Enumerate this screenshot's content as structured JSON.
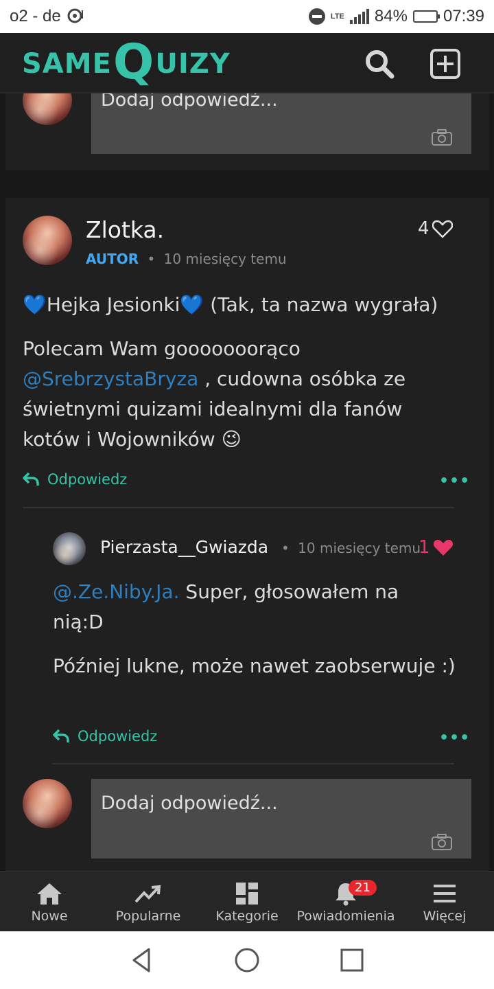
{
  "status_bar": {
    "carrier": "o2 - de",
    "network": "LTE",
    "battery_percent": "84%",
    "battery_level": 0.84,
    "time": "07:39"
  },
  "header": {
    "logo_same": "SAME",
    "logo_q": "Q",
    "logo_uizy": "UIZY",
    "brand_color": "#36c3a9",
    "search_icon": "search-icon",
    "add_icon": "plus-square-icon"
  },
  "top_reply": {
    "placeholder": "Dodaj odpowiedź..."
  },
  "comment": {
    "author": "Zlotka.",
    "badge": "AUTOR",
    "separator": "•",
    "time": "10 miesięcy temu",
    "likes": "4",
    "paragraph1": "💙Hejka Jesionki💙 (Tak, ta nazwa wygrała)",
    "p2_part1": "Polecam Wam gooooooorąco",
    "p2_mention": "@SrebrzystaBryza",
    "p2_part2": " , cudowna osóbka ze świetnymi quizami idealnymi dla fanów kotów i Wojowników 😉",
    "reply_label": "Odpowiedz",
    "more": "•••"
  },
  "nested_reply": {
    "author": "Pierzasta__Gwiazda",
    "separator": "•",
    "time": "10 miesięcy temu",
    "likes": "1",
    "p1_mention": "@.Ze.Niby.Ja.",
    "p1_text": " Super, głosowałem na nią:D",
    "p2": "Później lukne, może nawet zaobserwuje :)",
    "reply_label": "Odpowiedz",
    "more": "•••"
  },
  "bottom_reply": {
    "placeholder": "Dodaj odpowiedź..."
  },
  "bottom_nav": {
    "items": [
      {
        "label": "Nowe",
        "icon": "home-icon"
      },
      {
        "label": "Popularne",
        "icon": "trending-icon"
      },
      {
        "label": "Kategorie",
        "icon": "grid-icon"
      },
      {
        "label": "Powiadomienia",
        "icon": "bell-icon"
      },
      {
        "label": "Więcej",
        "icon": "menu-icon"
      }
    ],
    "notification_count": "21"
  },
  "system_nav": {
    "back": "back-icon",
    "home": "home-circle-icon",
    "recents": "recents-icon"
  }
}
